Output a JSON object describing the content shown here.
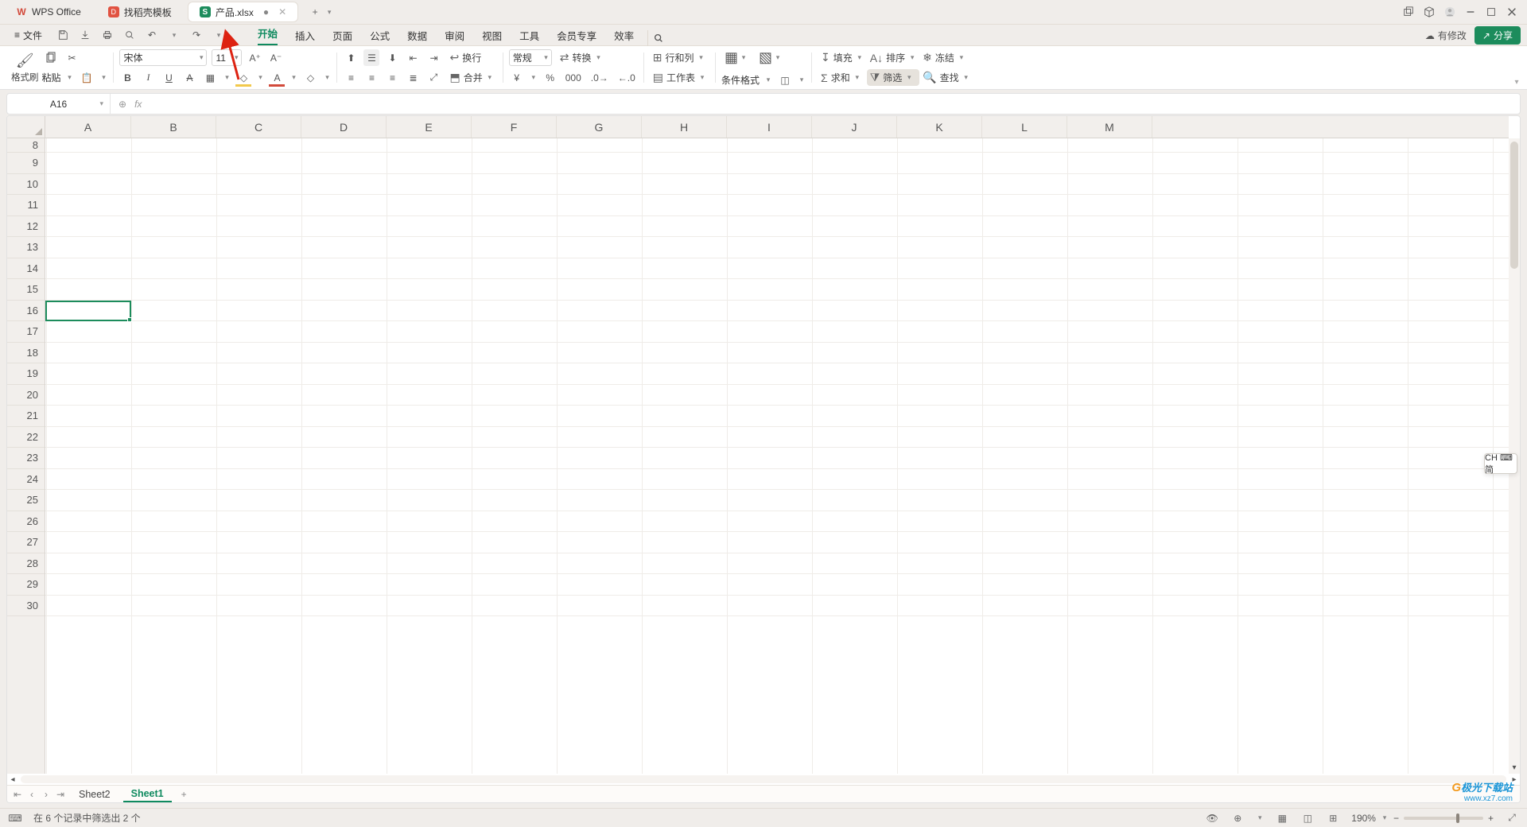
{
  "titlebar": {
    "tabs": [
      {
        "label": "WPS Office",
        "kind": "home"
      },
      {
        "label": "找稻壳模板",
        "kind": "template"
      },
      {
        "label": "产品.xlsx",
        "kind": "doc",
        "modified": "●"
      }
    ],
    "add": "+"
  },
  "filemenu": {
    "label": "文件"
  },
  "menutabs": [
    "开始",
    "插入",
    "页面",
    "公式",
    "数据",
    "审阅",
    "视图",
    "工具",
    "会员专享",
    "效率"
  ],
  "menuright": {
    "changes": "有修改",
    "share": "分享"
  },
  "ribbon": {
    "format_painter": "格式刷",
    "paste": "粘贴",
    "font_name": "宋体",
    "font_size": "11",
    "wrap": "换行",
    "merge": "合并",
    "num_fmt": "常规",
    "convert": "转换",
    "rowcol": "行和列",
    "worksheet": "工作表",
    "cond_fmt": "条件格式",
    "fill": "填充",
    "sort": "排序",
    "freeze": "冻结",
    "sum": "求和",
    "filter": "筛选",
    "find": "查找"
  },
  "namebox": "A16",
  "columns": [
    "A",
    "B",
    "C",
    "D",
    "E",
    "F",
    "G",
    "H",
    "I",
    "J",
    "K",
    "L",
    "M"
  ],
  "rows": [
    "8",
    "9",
    "10",
    "11",
    "12",
    "13",
    "14",
    "15",
    "16",
    "17",
    "18",
    "19",
    "20",
    "21",
    "22",
    "23",
    "24",
    "25",
    "26",
    "27",
    "28",
    "29",
    "30"
  ],
  "selected_row_index": 8,
  "sheets": {
    "list": [
      "Sheet2",
      "Sheet1"
    ],
    "active": 1,
    "add": "+"
  },
  "status": {
    "filter_msg": "在 6 个记录中筛选出 2 个",
    "zoom": "190%"
  },
  "ime": "CH ⌨ 简",
  "watermark": {
    "l1_g": "G",
    "l1": "极光下载站",
    "l2": "www.xz7.com"
  }
}
